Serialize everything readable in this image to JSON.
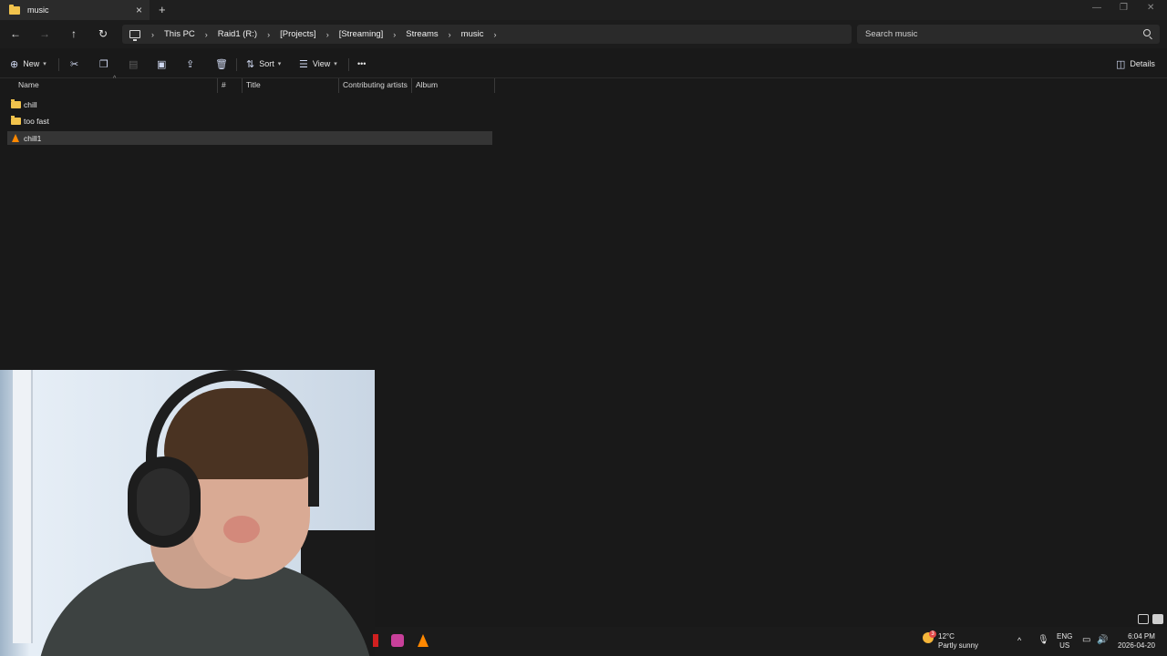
{
  "window": {
    "tab_title": "music",
    "tab_close": "×",
    "new_tab": "+",
    "minimize": "—",
    "restore": "❐",
    "close": "✕"
  },
  "nav": {
    "back": "←",
    "forward": "→",
    "up": "↑",
    "refresh": "↻",
    "breadcrumbs": [
      "This PC",
      "Raid1 (R:)",
      "[Projects]",
      "[Streaming]",
      "Streams",
      "music"
    ],
    "search_placeholder": "Search music"
  },
  "commands": {
    "new_label": "New",
    "sort_label": "Sort",
    "view_label": "View",
    "more_label": "•••",
    "details_label": "Details"
  },
  "columns": [
    "Name",
    "#",
    "Title",
    "Contributing artists",
    "Album"
  ],
  "files": [
    {
      "name": "chill",
      "type": "folder",
      "selected": false
    },
    {
      "name": "too fast",
      "type": "folder",
      "selected": false
    },
    {
      "name": "chill1",
      "type": "vlc-media",
      "selected": true
    }
  ],
  "taskbar": {
    "weather_temp": "12°C",
    "weather_desc": "Partly sunny",
    "weather_badge": "3",
    "lang_top": "ENG",
    "lang_bottom": "US",
    "time": "6:04 PM",
    "date": "2026-04-20",
    "chevron_up": "^"
  },
  "icons": {
    "folder": "folder-icon",
    "vlc": "vlc-cone-icon",
    "search": "search-icon",
    "pc": "this-pc-icon"
  },
  "colors": {
    "background": "#191919",
    "folder": "#f2c34c",
    "vlc": "#ff8800",
    "selection": "#353535"
  }
}
